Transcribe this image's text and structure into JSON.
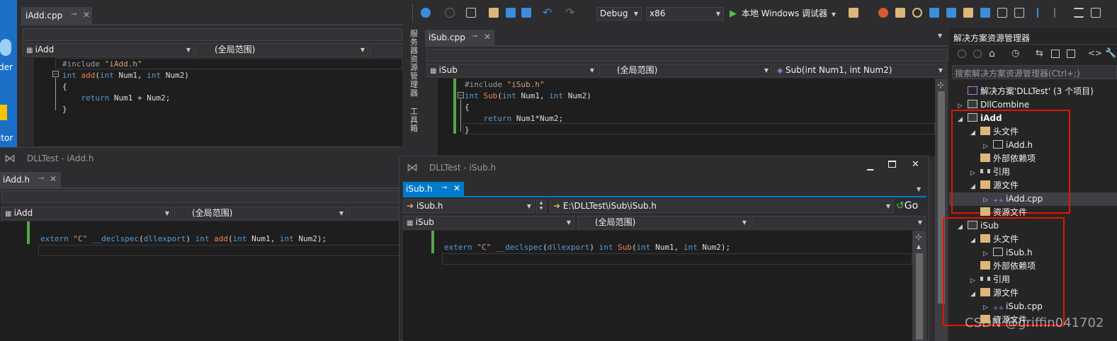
{
  "desktop": {
    "icon_labels": [
      "der",
      "itor"
    ]
  },
  "toolbar": {
    "config": "Debug",
    "platform": "x86",
    "run_label": "本地 Windows 调试器"
  },
  "side_tabs": {
    "server_explorer": "服务器资源管理器",
    "toolbox": "工具箱"
  },
  "window_iadd_cpp": {
    "tab": "iAdd.cpp",
    "scope_left": "iAdd",
    "scope_mid": "(全局范围)",
    "code": [
      [
        {
          "t": "#include ",
          "c": "pp"
        },
        {
          "t": "\"iAdd.h\"",
          "c": "str"
        }
      ],
      [
        {
          "t": "int ",
          "c": "kw"
        },
        {
          "t": "add",
          "c": "fn"
        },
        {
          "t": "(",
          "c": "txt"
        },
        {
          "t": "int ",
          "c": "kw"
        },
        {
          "t": "Num1, ",
          "c": "txt"
        },
        {
          "t": "int ",
          "c": "kw"
        },
        {
          "t": "Num2)",
          "c": "txt"
        }
      ],
      [
        {
          "t": "{",
          "c": "txt"
        }
      ],
      [
        {
          "t": "    return ",
          "c": "kw"
        },
        {
          "t": "Num1 + Num2;",
          "c": "txt"
        }
      ],
      [
        {
          "t": "}",
          "c": "txt"
        }
      ]
    ]
  },
  "window_isub_cpp": {
    "tab": "iSub.cpp",
    "scope_left": "iSub",
    "scope_mid": "(全局范围)",
    "scope_right": "Sub(int Num1, int Num2)",
    "code": [
      [
        {
          "t": "#include ",
          "c": "pp"
        },
        {
          "t": "\"iSub.h\"",
          "c": "str"
        }
      ],
      [
        {
          "t": "int ",
          "c": "kw"
        },
        {
          "t": "Sub",
          "c": "fn"
        },
        {
          "t": "(",
          "c": "txt"
        },
        {
          "t": "int ",
          "c": "kw"
        },
        {
          "t": "Num1, ",
          "c": "txt"
        },
        {
          "t": "int ",
          "c": "kw"
        },
        {
          "t": "Num2)",
          "c": "txt"
        }
      ],
      [
        {
          "t": "{",
          "c": "txt"
        }
      ],
      [
        {
          "t": "    return ",
          "c": "kw"
        },
        {
          "t": "Num1*Num2;",
          "c": "txt"
        }
      ],
      [
        {
          "t": "}",
          "c": "txt"
        }
      ]
    ]
  },
  "window_iadd_h": {
    "title": "DLLTest - iAdd.h",
    "tab": "iAdd.h",
    "scope_left": "iAdd",
    "scope_mid": "(全局范围)",
    "code": [
      [
        {
          "t": "extern ",
          "c": "kw"
        },
        {
          "t": "\"C\" ",
          "c": "str"
        },
        {
          "t": "__declspec",
          "c": "kw"
        },
        {
          "t": "(",
          "c": "txt"
        },
        {
          "t": "dllexport",
          "c": "kw"
        },
        {
          "t": ") ",
          "c": "txt"
        },
        {
          "t": "int ",
          "c": "kw"
        },
        {
          "t": "add",
          "c": "fn"
        },
        {
          "t": "(",
          "c": "txt"
        },
        {
          "t": "int ",
          "c": "kw"
        },
        {
          "t": "Num1, ",
          "c": "txt"
        },
        {
          "t": "int ",
          "c": "kw"
        },
        {
          "t": "Num2);",
          "c": "txt"
        }
      ]
    ]
  },
  "window_isub_h": {
    "title": "DLLTest - iSub.h",
    "tab": "iSub.h",
    "file_left": "iSub.h",
    "path": "E:\\DLLTest\\iSub\\iSub.h",
    "go_label": "Go",
    "scope_left": "iSub",
    "scope_mid": "(全局范围)",
    "code": [
      [
        {
          "t": "extern ",
          "c": "kw"
        },
        {
          "t": "\"C\" ",
          "c": "str"
        },
        {
          "t": "__declspec",
          "c": "kw"
        },
        {
          "t": "(",
          "c": "txt"
        },
        {
          "t": "dllexport",
          "c": "kw"
        },
        {
          "t": ") ",
          "c": "txt"
        },
        {
          "t": "int ",
          "c": "kw"
        },
        {
          "t": "Sub",
          "c": "fn"
        },
        {
          "t": "(",
          "c": "txt"
        },
        {
          "t": "int ",
          "c": "kw"
        },
        {
          "t": "Num1, ",
          "c": "txt"
        },
        {
          "t": "int ",
          "c": "kw"
        },
        {
          "t": "Num2);",
          "c": "txt"
        }
      ]
    ]
  },
  "solution_explorer": {
    "title": "解决方案资源管理器",
    "search_placeholder": "搜索解决方案资源管理器(Ctrl+;)",
    "tree": [
      {
        "label": "解决方案'DLLTest' (3 个项目)",
        "indent": 0,
        "tri": "",
        "icon": "sln",
        "bold": false
      },
      {
        "label": "DllCombine",
        "indent": 0,
        "tri": "▷",
        "icon": "proj",
        "bold": false
      },
      {
        "label": "iAdd",
        "indent": 0,
        "tri": "◢",
        "icon": "proj",
        "bold": true
      },
      {
        "label": "头文件",
        "indent": 1,
        "tri": "◢",
        "icon": "folder",
        "bold": false
      },
      {
        "label": "iAdd.h",
        "indent": 2,
        "tri": "▷",
        "icon": "doc",
        "bold": false
      },
      {
        "label": "外部依赖项",
        "indent": 1,
        "tri": "",
        "icon": "folder",
        "bold": false
      },
      {
        "label": "引用",
        "indent": 1,
        "tri": "▷",
        "icon": "ref",
        "bold": false
      },
      {
        "label": "源文件",
        "indent": 1,
        "tri": "◢",
        "icon": "folder",
        "bold": false
      },
      {
        "label": "iAdd.cpp",
        "indent": 2,
        "tri": "▷",
        "icon": "cpp",
        "bold": false
      },
      {
        "label": "资源文件",
        "indent": 1,
        "tri": "",
        "icon": "folder",
        "bold": false
      },
      {
        "label": "iSub",
        "indent": 0,
        "tri": "◢",
        "icon": "proj",
        "bold": false
      },
      {
        "label": "头文件",
        "indent": 1,
        "tri": "◢",
        "icon": "folder",
        "bold": false
      },
      {
        "label": "iSub.h",
        "indent": 2,
        "tri": "▷",
        "icon": "doc",
        "bold": false
      },
      {
        "label": "外部依赖项",
        "indent": 1,
        "tri": "",
        "icon": "folder",
        "bold": false
      },
      {
        "label": "引用",
        "indent": 1,
        "tri": "▷",
        "icon": "ref",
        "bold": false
      },
      {
        "label": "源文件",
        "indent": 1,
        "tri": "◢",
        "icon": "folder",
        "bold": false
      },
      {
        "label": "iSub.cpp",
        "indent": 2,
        "tri": "▷",
        "icon": "cpp",
        "bold": false
      },
      {
        "label": "资源文件",
        "indent": 1,
        "tri": "",
        "icon": "folder",
        "bold": false
      }
    ]
  },
  "watermark": "CSDN @griffin041702",
  "colors": {
    "accent": "#007acc",
    "editor_bg": "#1e1e1e",
    "highlight_box": "#e51400"
  }
}
